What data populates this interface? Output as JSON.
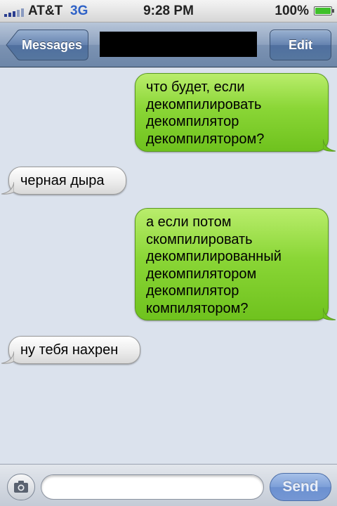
{
  "status_bar": {
    "carrier": "AT&T",
    "network": "3G",
    "time": "9:28 PM",
    "battery": "100%",
    "battery_level": 1.0
  },
  "nav": {
    "back_label": "Messages",
    "edit_label": "Edit"
  },
  "messages": [
    {
      "side": "out",
      "text": "что будет, если декомпилировать декомпилятор декомпилятором?"
    },
    {
      "side": "in",
      "text": "черная дыра"
    },
    {
      "side": "out",
      "text": "а если потом скомпилировать декомпилированный декомпилятором декомпилятор компилятором?"
    },
    {
      "side": "in",
      "text": "ну тебя нахрен"
    }
  ],
  "composer": {
    "input_value": "",
    "send_label": "Send"
  },
  "icons": {
    "back": "back-arrow-button",
    "camera": "camera-icon",
    "battery": "battery-icon",
    "signal": "signal-bars-icon"
  },
  "colors": {
    "outgoing_bubble": "#8ad636",
    "incoming_bubble": "#ececec",
    "background": "#dbe2ed",
    "nav_bar": "#7c93b3",
    "network_3g": "#2f62c7"
  }
}
